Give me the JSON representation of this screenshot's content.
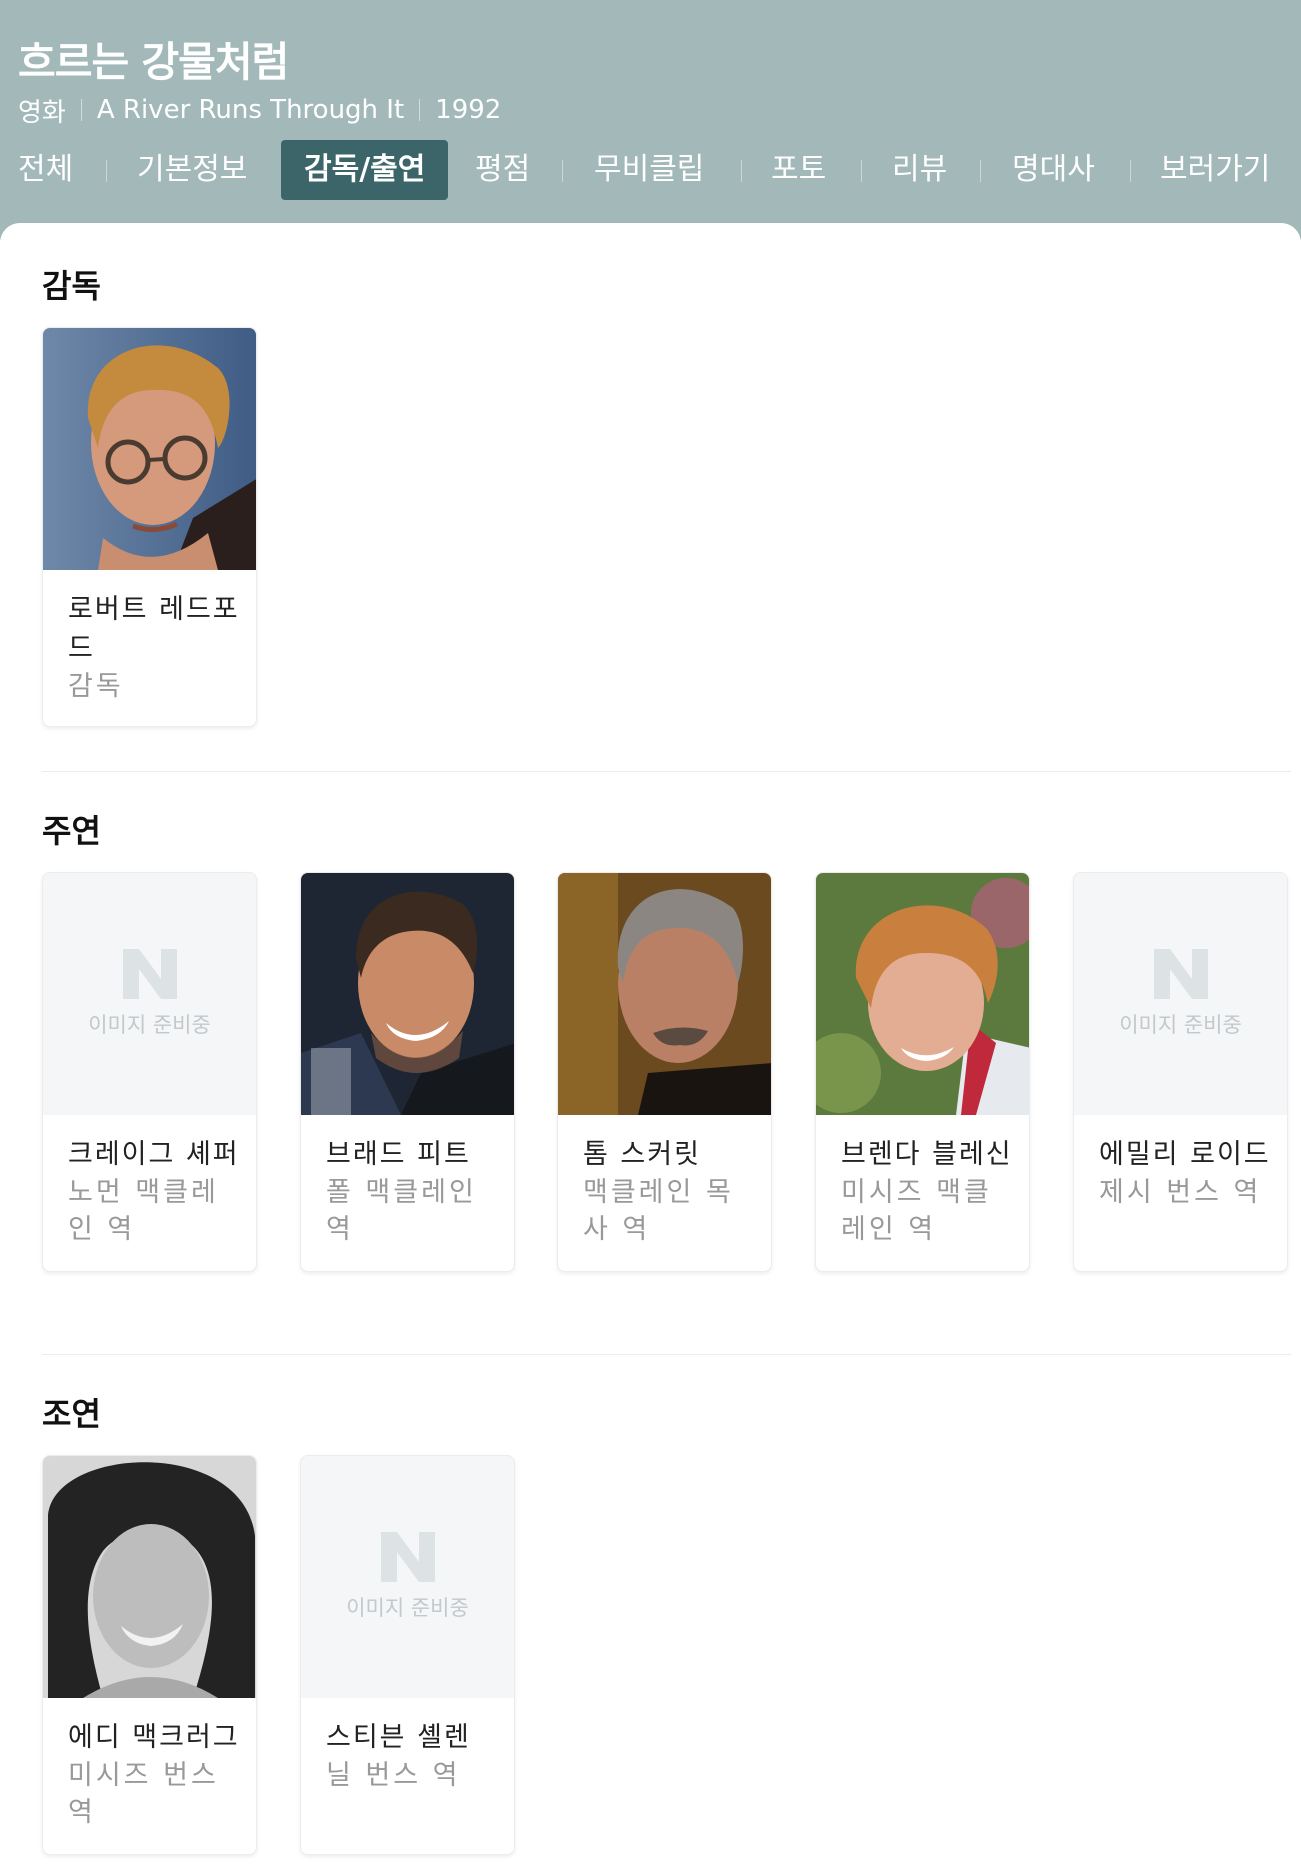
{
  "header": {
    "title": "흐르는 강물처럼",
    "category": "영화",
    "original_title": "A River Runs Through It",
    "year": "1992"
  },
  "tabs": [
    {
      "label": "전체"
    },
    {
      "label": "기본정보"
    },
    {
      "label": "감독/출연",
      "active": true
    },
    {
      "label": "평점"
    },
    {
      "label": "무비클립"
    },
    {
      "label": "포토"
    },
    {
      "label": "리뷰"
    },
    {
      "label": "명대사"
    },
    {
      "label": "보러가기"
    }
  ],
  "placeholder": {
    "logo": "N",
    "label": "이미지 준비중"
  },
  "sections": {
    "director": {
      "title": "감독",
      "people": [
        {
          "name": "로버트 레드포드",
          "role": "감독",
          "image": "director-portrait"
        }
      ]
    },
    "lead": {
      "title": "주연",
      "people": [
        {
          "name": "크레이그 셰퍼",
          "role": "노먼 맥클레인 역",
          "image": "placeholder"
        },
        {
          "name": "브래드 피트",
          "role": "폴 맥클레인 역",
          "image": "portrait"
        },
        {
          "name": "톰 스커릿",
          "role": "맥클레인 목사 역",
          "image": "portrait"
        },
        {
          "name": "브렌다 블레신",
          "role": "미시즈 맥클레인 역",
          "image": "portrait"
        },
        {
          "name": "에밀리 로이드",
          "role": "제시 번스 역",
          "image": "placeholder"
        }
      ]
    },
    "supporting": {
      "title": "조연",
      "people": [
        {
          "name": "에디 맥크러그",
          "role": "미시즈 번스 역",
          "image": "portrait"
        },
        {
          "name": "스티븐 셸렌",
          "role": "닐 번스 역",
          "image": "placeholder"
        }
      ]
    }
  },
  "colors": {
    "header_bg": "#a2b8b9",
    "active_tab_bg": "#3b6568",
    "card_border": "#ececec",
    "role_text": "#999999"
  }
}
